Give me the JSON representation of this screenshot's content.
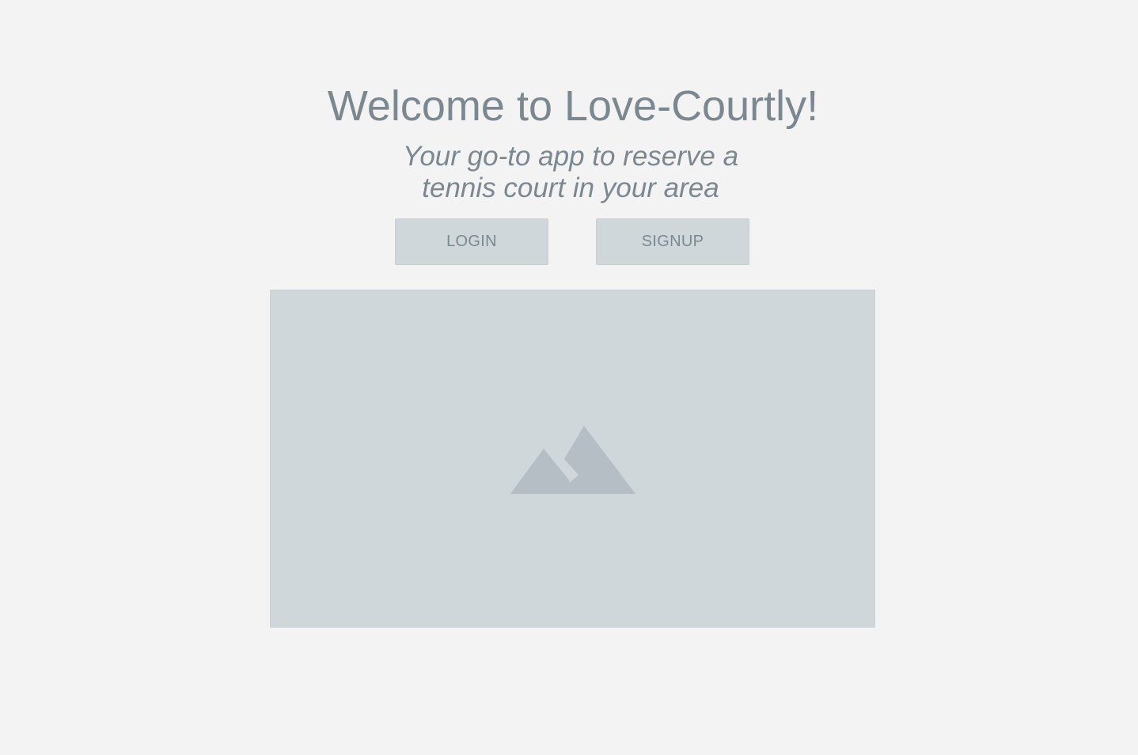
{
  "hero": {
    "title": "Welcome to Love-Courtly!",
    "subtitle_line1": "Your go-to app to reserve a",
    "subtitle_line2": "tennis court in your area"
  },
  "actions": {
    "login_label": "LOGIN",
    "signup_label": "SIGNUP"
  },
  "image": {
    "icon": "mountain-icon"
  },
  "colors": {
    "background": "#f3f3f3",
    "text": "#7b8890",
    "button": "#d0d7db",
    "image_placeholder": "#d0d7db",
    "icon": "#b4bec4"
  }
}
